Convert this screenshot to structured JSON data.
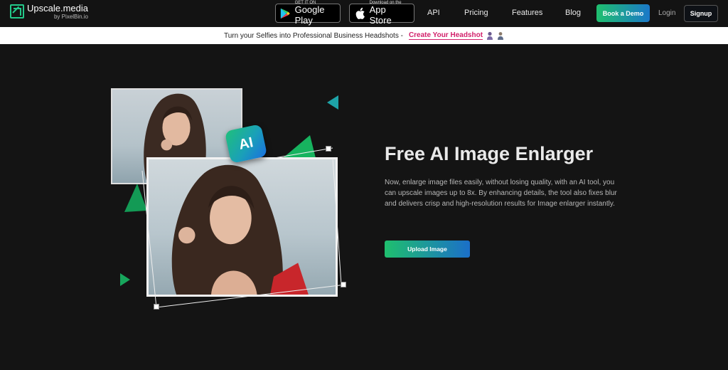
{
  "nav": {
    "brand_name": "Upscale.media",
    "brand_sub": "by PixelBin.io",
    "google_play": {
      "small": "GET IT ON",
      "big": "Google Play"
    },
    "app_store": {
      "small": "Download on the",
      "big": "App Store"
    },
    "links": [
      "API",
      "Pricing",
      "Features",
      "Blog"
    ],
    "book_demo": "Book a Demo",
    "login": "Login",
    "signup": "Signup"
  },
  "banner": {
    "text": "Turn your Selfies into Professional Business Headshots -",
    "link": "Create Your Headshot"
  },
  "hero": {
    "badge": "AI",
    "title": "Free AI Image Enlarger",
    "description": "Now, enlarge image files easily, without losing quality, with an AI tool, you can upscale images up to 8x. By enhancing details, the tool also fixes blur and delivers crisp and high-resolution results for Image enlarger instantly.",
    "upload_button": "Upload Image"
  },
  "icons": {
    "logo": "upscale-arrow-icon",
    "google_play": "google-play-icon",
    "app_store": "apple-icon",
    "banner_avatars": [
      "female-avatar-icon",
      "male-avatar-icon"
    ]
  },
  "colors": {
    "accent_green": "#1fbf6e",
    "accent_blue": "#1b6fc9",
    "banner_link": "#d2216b",
    "background": "#141414"
  }
}
